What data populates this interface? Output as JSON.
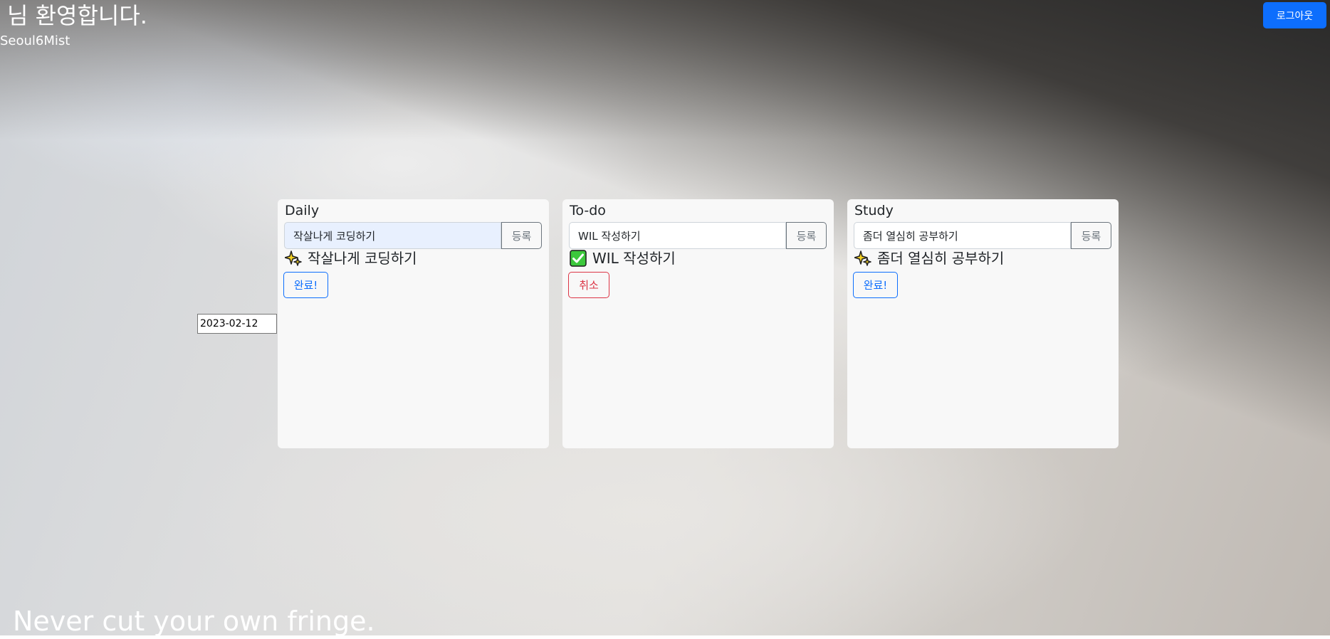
{
  "header": {
    "welcome": "님 환영합니다.",
    "username": "Seoul6Mist",
    "logout_label": "로그아웃"
  },
  "date": {
    "value": "2023-02-12"
  },
  "columns": [
    {
      "title": "Daily",
      "input_value": "작살나게 코딩하기",
      "add_label": "등록",
      "item": {
        "icon": "sparkle-icon",
        "text": "작살나게 코딩하기"
      },
      "action_label": "완료!"
    },
    {
      "title": "To-do",
      "input_value": "WIL 작성하기",
      "add_label": "등록",
      "item": {
        "icon": "check-mark-icon",
        "text": "WIL 작성하기"
      },
      "action_label": "취소"
    },
    {
      "title": "Study",
      "input_value": "좀더 열심히 공부하기",
      "add_label": "등록",
      "item": {
        "icon": "sparkle-icon",
        "text": "좀더 열심히 공부하기"
      },
      "action_label": "완료!"
    }
  ],
  "footer": {
    "quote": "Never cut your own fringe."
  },
  "colors": {
    "primary": "#0d6efd",
    "danger": "#dc3545",
    "secondary": "#6c757d"
  }
}
